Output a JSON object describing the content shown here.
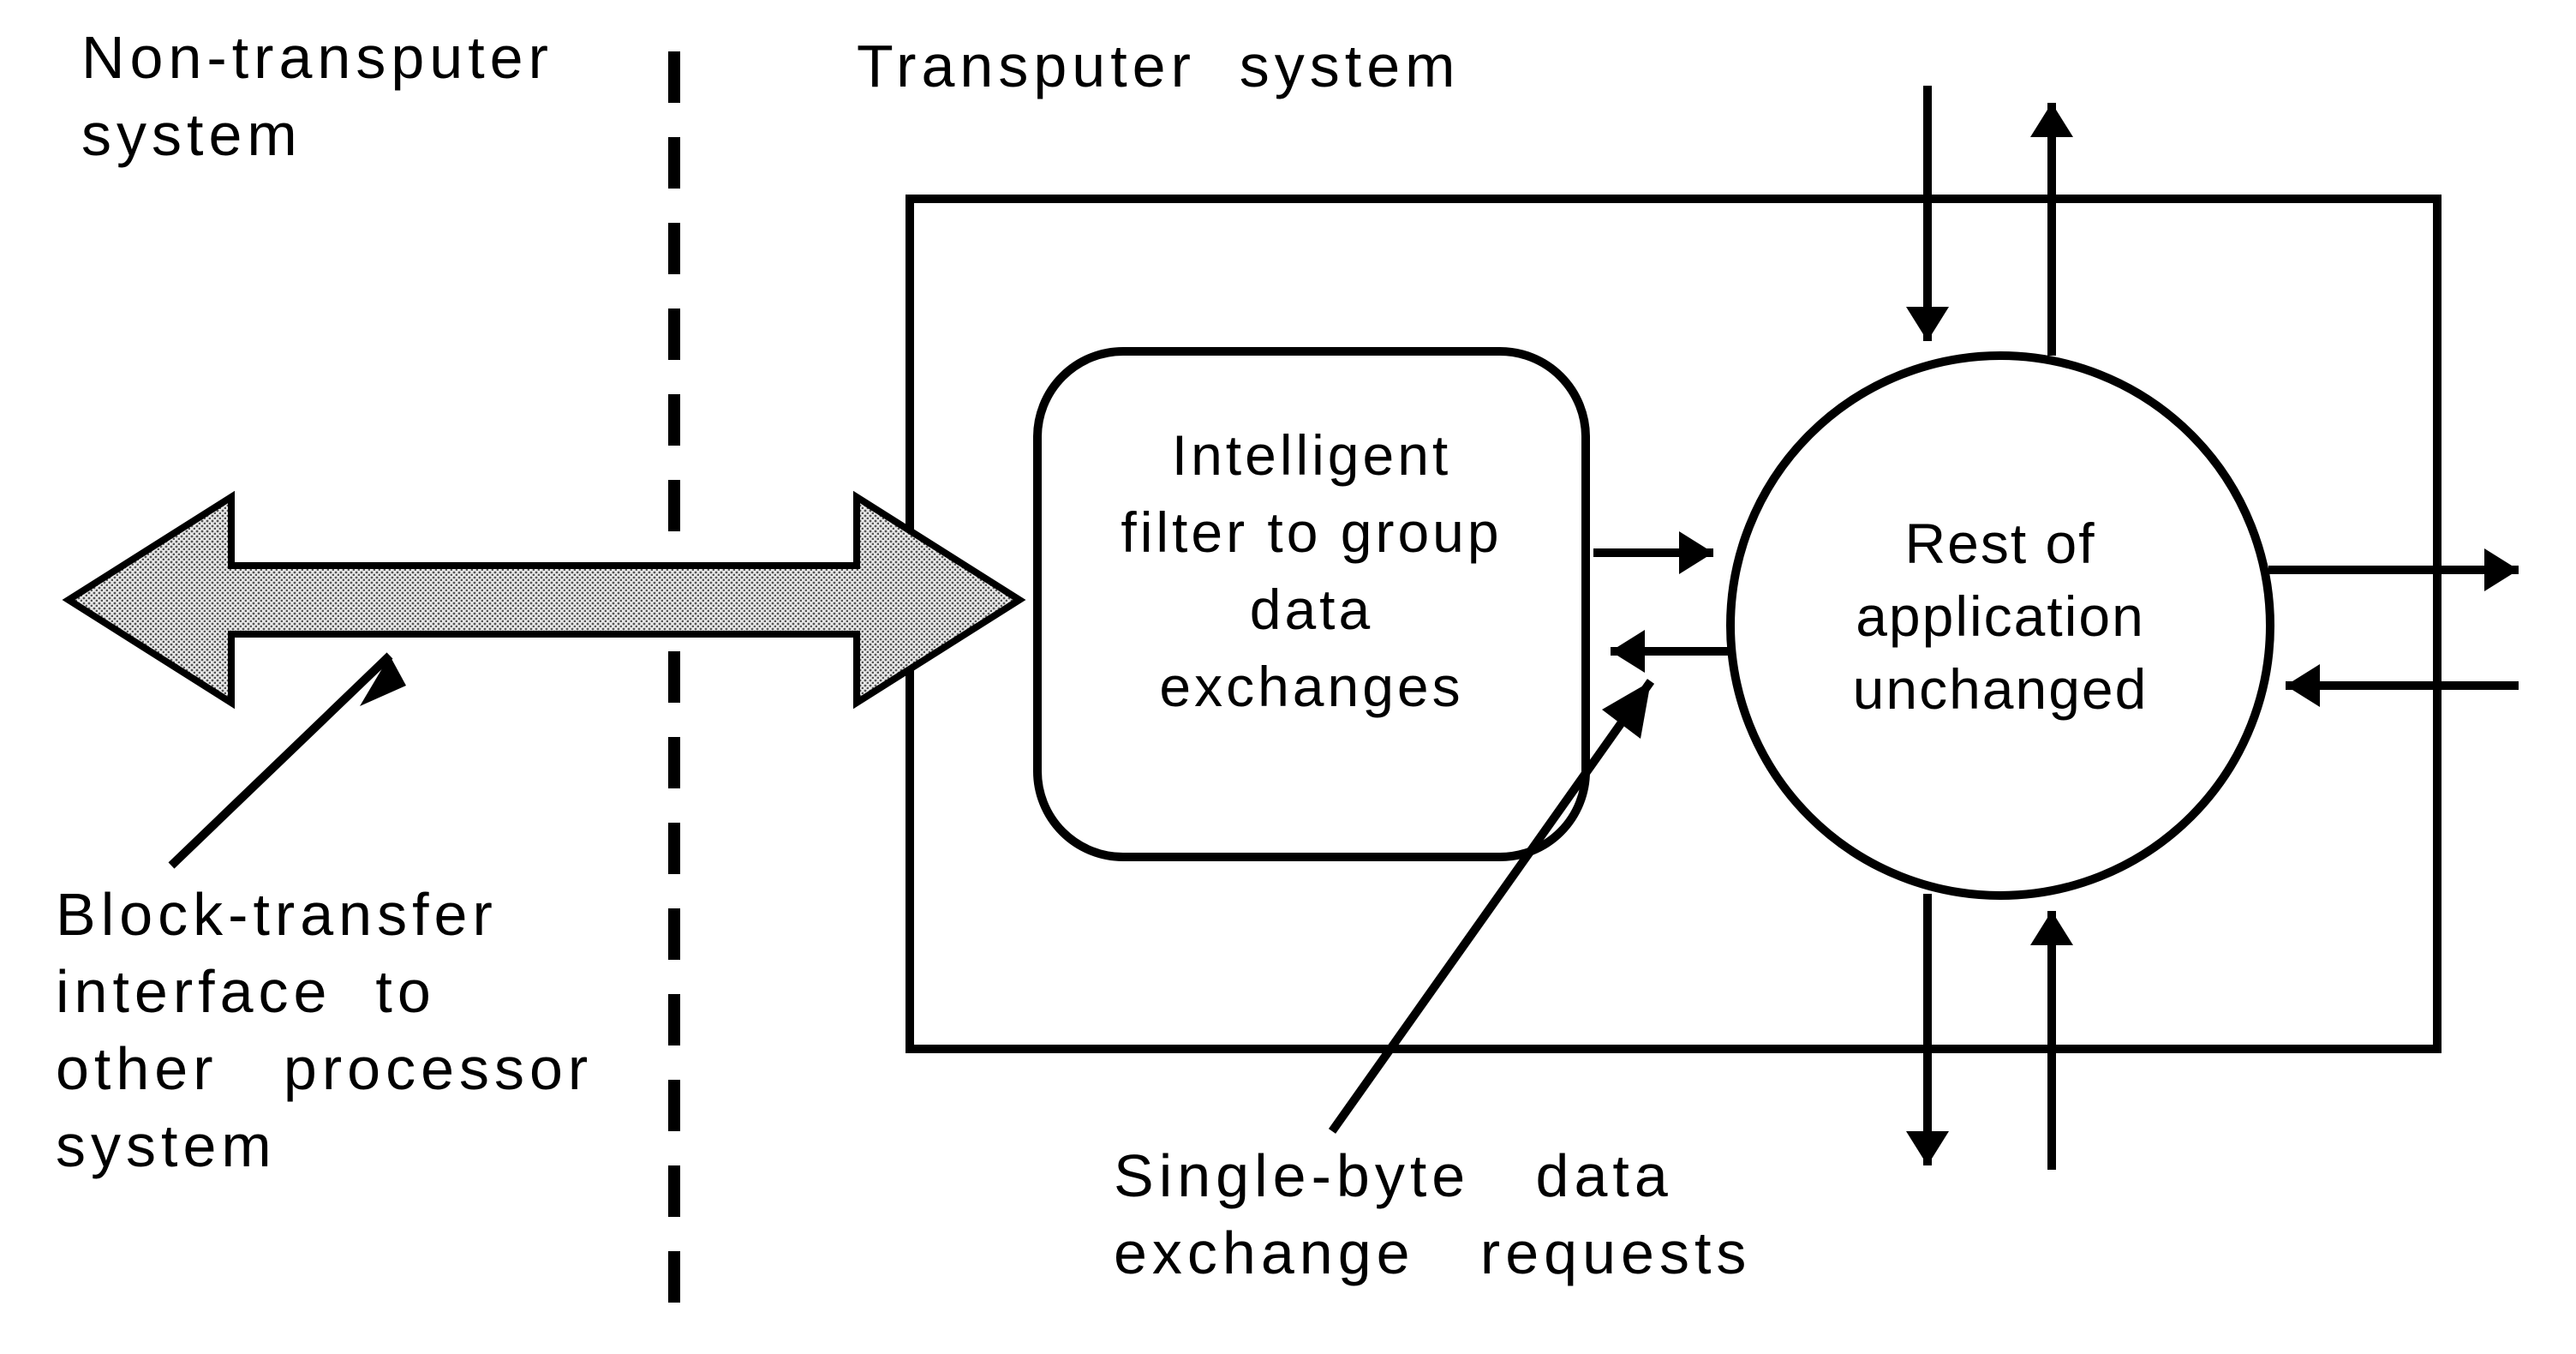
{
  "labels": {
    "non_transputer_line1": "Non-transputer",
    "non_transputer_line2": "system",
    "transputer_system": "Transputer  system",
    "block_transfer_line1": "Block-transfer",
    "block_transfer_line2": "interface  to",
    "block_transfer_line3": "other   processor",
    "block_transfer_line4": "system",
    "single_byte_line1": "Single-byte   data",
    "single_byte_line2": "exchange   requests"
  },
  "filter": {
    "line1": "Intelligent",
    "line2": "filter  to  group",
    "line3": "data",
    "line4": "exchanges"
  },
  "circle": {
    "line1": "Rest  of",
    "line2": "application",
    "line3": "unchanged"
  }
}
